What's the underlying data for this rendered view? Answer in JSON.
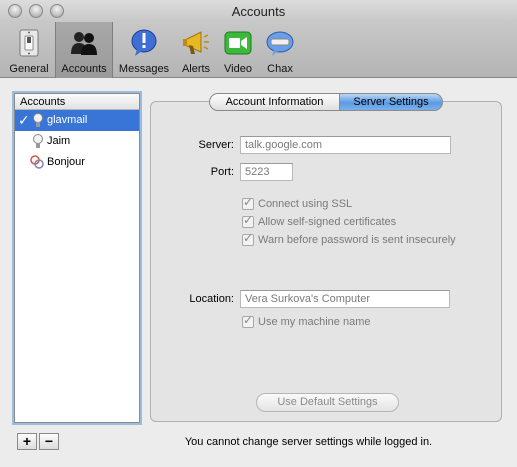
{
  "window": {
    "title": "Accounts"
  },
  "toolbar": {
    "items": [
      {
        "label": "General",
        "icon": "light-switch-icon"
      },
      {
        "label": "Accounts",
        "icon": "people-icon",
        "active": true
      },
      {
        "label": "Messages",
        "icon": "speech-bubble-icon"
      },
      {
        "label": "Alerts",
        "icon": "megaphone-icon"
      },
      {
        "label": "Video",
        "icon": "video-camera-icon"
      },
      {
        "label": "Chax",
        "icon": "chax-icon"
      }
    ]
  },
  "accounts": {
    "header": "Accounts",
    "items": [
      {
        "name": "glavmail",
        "icon": "lightbulb-icon",
        "selected": true,
        "checked": true
      },
      {
        "name": "Jaim",
        "icon": "lightbulb-icon",
        "selected": false
      },
      {
        "name": "Bonjour",
        "icon": "bonjour-icon",
        "selected": false
      }
    ],
    "add_label": "+",
    "remove_label": "−"
  },
  "tabs": [
    {
      "label": "Account Information",
      "selected": false
    },
    {
      "label": "Server Settings",
      "selected": true
    }
  ],
  "server_settings": {
    "server_label": "Server:",
    "server_value": "talk.google.com",
    "port_label": "Port:",
    "port_value": "5223",
    "options": [
      {
        "label": "Connect using SSL",
        "checked": true
      },
      {
        "label": "Allow self-signed certificates",
        "checked": true
      },
      {
        "label": "Warn before password is sent insecurely",
        "checked": true
      }
    ],
    "location_label": "Location:",
    "location_value": "Vera Surkova's Computer",
    "use_machine_name_label": "Use my machine name",
    "default_button": "Use Default Settings"
  },
  "status_text": "You cannot change server settings while logged in.",
  "colors": {
    "selection": "#3875d7",
    "accent_tab": "#5a9be4"
  }
}
